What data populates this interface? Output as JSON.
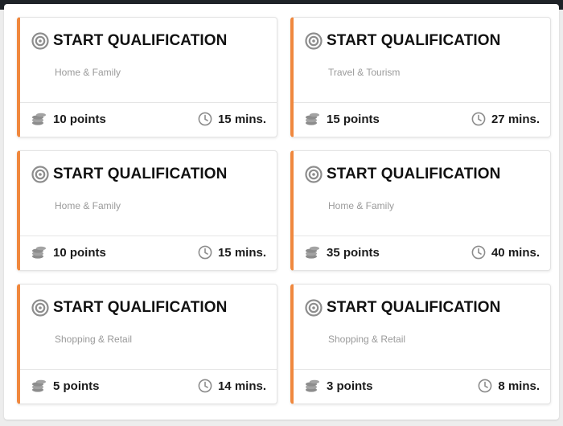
{
  "colors": {
    "accent": "#f0883e",
    "title_text": "#111111",
    "category_text": "#9a9a9a",
    "icon_gray": "#8d8d8d",
    "topbar": "#1f2328"
  },
  "icons": {
    "title": "target-icon",
    "points": "coins-icon",
    "duration": "clock-icon"
  },
  "cards": [
    {
      "title": "START QUALIFICATION",
      "category": "Home & Family",
      "points": "10 points",
      "duration": "15 mins."
    },
    {
      "title": "START QUALIFICATION",
      "category": "Travel & Tourism",
      "points": "15 points",
      "duration": "27 mins."
    },
    {
      "title": "START QUALIFICATION",
      "category": "Home & Family",
      "points": "10 points",
      "duration": "15 mins."
    },
    {
      "title": "START QUALIFICATION",
      "category": "Home & Family",
      "points": "35 points",
      "duration": "40 mins."
    },
    {
      "title": "START QUALIFICATION",
      "category": "Shopping & Retail",
      "points": "5 points",
      "duration": "14 mins."
    },
    {
      "title": "START QUALIFICATION",
      "category": "Shopping & Retail",
      "points": "3 points",
      "duration": "8 mins."
    }
  ]
}
